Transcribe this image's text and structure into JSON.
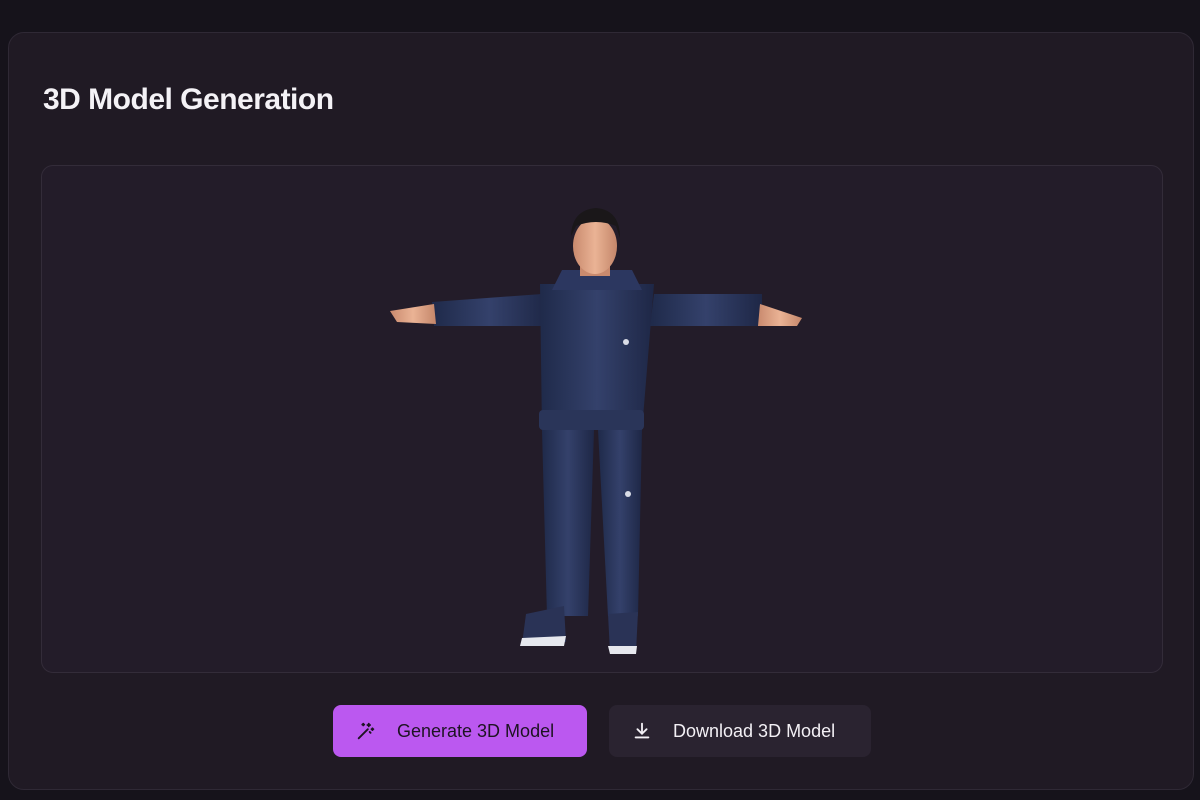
{
  "panel": {
    "title": "3D Model Generation"
  },
  "viewer": {
    "model_label": "3D character model in T-pose"
  },
  "actions": {
    "generate_label": "Generate 3D Model",
    "generate_icon": "magic-wand-icon",
    "download_label": "Download 3D Model",
    "download_icon": "download-icon"
  },
  "colors": {
    "background": "#16131b",
    "panel": "#201a24",
    "viewer": "#231c29",
    "accent": "#bb58f0",
    "secondary_button": "#2a2330"
  }
}
